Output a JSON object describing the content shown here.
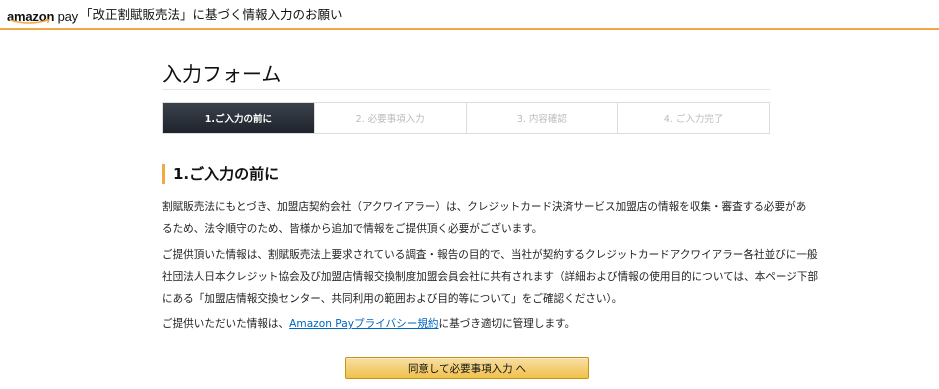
{
  "header": {
    "logo": {
      "brand": "amazon",
      "suffix": " pay",
      "icon": "amazon-smile-icon"
    },
    "title": "「改正割賦販売法」に基づく情報入力のお願い"
  },
  "page": {
    "title": "入力フォーム"
  },
  "steps": [
    {
      "label": "1.ご入力の前に",
      "active": true
    },
    {
      "label": "2. 必要事項入力",
      "active": false
    },
    {
      "label": "3. 内容確認",
      "active": false
    },
    {
      "label": "4. ご入力完了",
      "active": false
    }
  ],
  "section": {
    "heading": "1.ご入力の前に",
    "para1": [
      "割賦販売法にもとづき、加盟店契約会社（アクワイアラー）は、クレジットカード決済サービス加盟店の情報を収集・審査する必要があ",
      "るため、法令順守のため、皆様から追加で情報をご提供頂く必要がございます。"
    ],
    "para2": [
      "ご提供頂いた情報は、割賦販売法上要求されている調査・報告の目的で、当社が契約するクレジットカードアクワイアラー各社並びに一般",
      "社団法人日本クレジット協会及び加盟店情報交換制度加盟会員会社に共有されます（詳細および情報の使用目的については、本ページ下部",
      "にある「加盟店情報交換センター、共同利用の範囲および目的等について」をご確認ください）。"
    ],
    "para3": {
      "before": "ご提供いただいた情報は、",
      "link": "Amazon Payプライバシー規約",
      "after": "に基づき適切に管理します。"
    }
  },
  "actions": {
    "agree_label": "同意して必要事項入力 へ"
  },
  "colors": {
    "accent": "#f3a847",
    "button_top": "#f7dfa5",
    "button_bottom": "#f0c14b",
    "active_step": "#232f3e",
    "link": "#0066c0"
  }
}
